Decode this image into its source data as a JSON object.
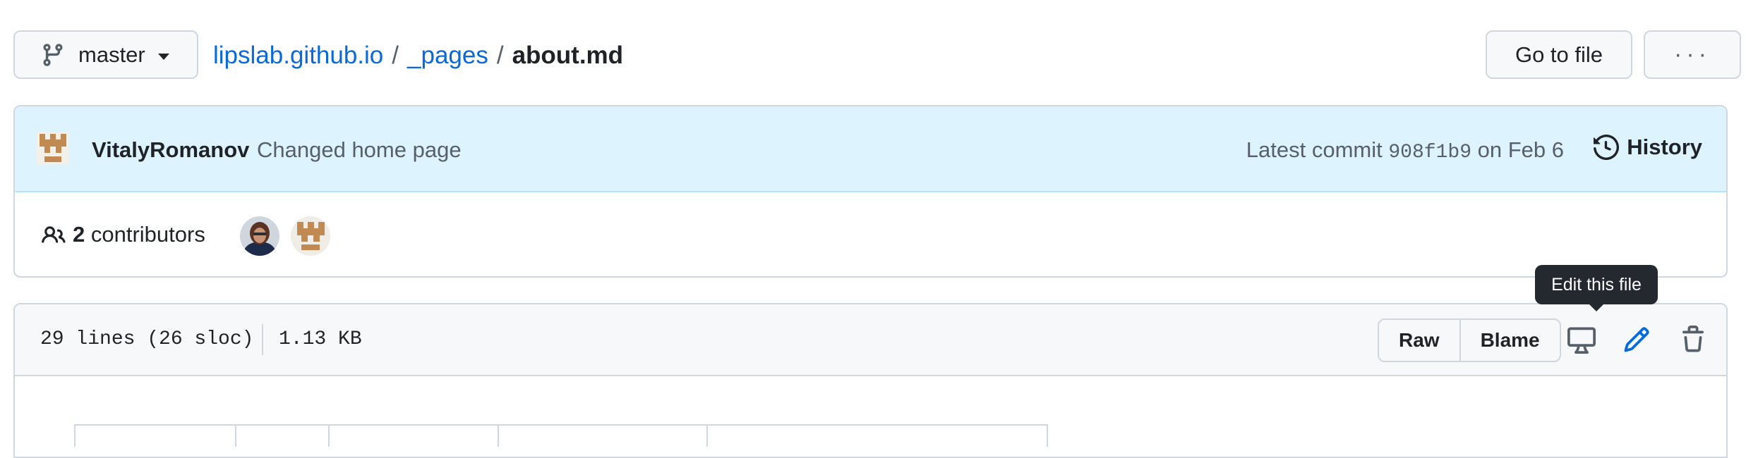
{
  "breadcrumb": {
    "branch": "master",
    "repo": "lipslab.github.io",
    "sep1": "/",
    "folder": "_pages",
    "sep2": "/",
    "file": "about.md"
  },
  "actions": {
    "goto_file": "Go to file",
    "more": "···"
  },
  "commit": {
    "author": "VitalyRomanov",
    "message": "Changed home page",
    "latest_prefix": "Latest commit",
    "sha": "908f1b9",
    "date": "on Feb 6",
    "history_label": "History"
  },
  "contributors": {
    "count": "2",
    "label": "contributors"
  },
  "file": {
    "lines": "29 lines (26 sloc)",
    "size": "1.13 KB",
    "raw_label": "Raw",
    "blame_label": "Blame",
    "tooltip": "Edit this file"
  },
  "colors": {
    "link": "#0969da",
    "commit_bar": "#ddf4ff",
    "border": "#d0d7de",
    "tooltip_bg": "#24292f"
  },
  "icons": [
    "git-branch-icon",
    "kebab-horizontal-icon",
    "history-icon",
    "people-icon",
    "desktop-icon",
    "pencil-icon",
    "trash-icon"
  ]
}
